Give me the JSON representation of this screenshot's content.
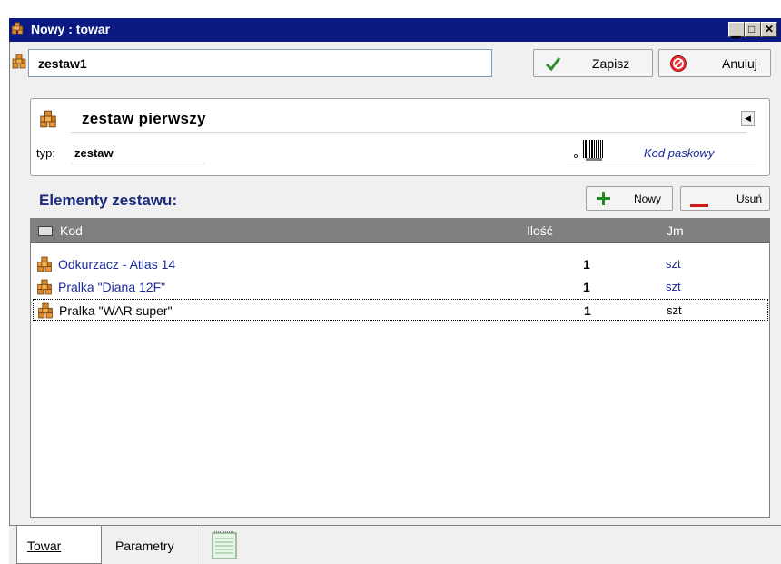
{
  "window": {
    "title": "Nowy : towar",
    "controls": [
      "minimize",
      "maximize",
      "close"
    ]
  },
  "toolbar": {
    "code_value": "zestaw1",
    "save_label": "Zapisz",
    "cancel_label": "Anuluj"
  },
  "product": {
    "name": "zestaw pierwszy",
    "type_label": "typ:",
    "type_value": "zestaw",
    "barcode_link": "Kod paskowy"
  },
  "elements": {
    "header": "Elementy zestawu:",
    "new_label": "Nowy",
    "delete_label": "Usuń",
    "columns": [
      "Kod",
      "Ilość",
      "Jm"
    ],
    "rows": [
      {
        "name": "Odkurzacz - Atlas 14",
        "qty": "1",
        "unit": "szt"
      },
      {
        "name": "Pralka \"Diana 12F\"",
        "qty": "1",
        "unit": "szt"
      },
      {
        "name": "Pralka \"WAR super\"",
        "qty": "1",
        "unit": "szt"
      }
    ]
  },
  "tabs": [
    "Towar",
    "Parametry"
  ],
  "colors": {
    "title_bar": "#0a1a82",
    "link_text": "#1a2a9a",
    "section_header": "#1c2a7c",
    "list_header": "#808080"
  },
  "icons": [
    "boxes-icon",
    "check-icon",
    "no-entry-icon",
    "barcode-icon",
    "plus-icon",
    "minus-icon",
    "notes-icon"
  ]
}
